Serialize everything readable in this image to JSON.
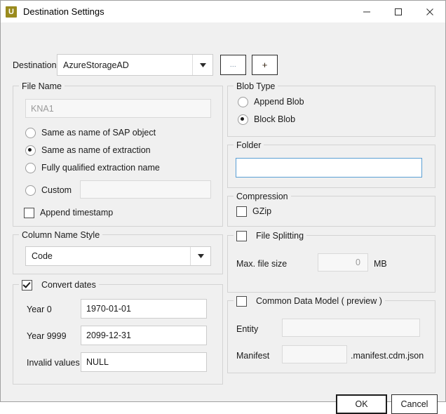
{
  "window": {
    "title": "Destination Settings",
    "app_icon": "u-app-icon",
    "icon_letter": "U",
    "controls": {
      "minimize": "minimize-icon",
      "maximize": "maximize-icon",
      "close": "close-icon"
    }
  },
  "destination": {
    "label": "Destination",
    "value": "AzureStorageAD",
    "dropdown_icon": "chevron-down-icon",
    "browse_button": "...",
    "add_button": "+"
  },
  "file_name": {
    "title": "File Name",
    "preview_value": "KNA1",
    "options": [
      {
        "label": "Same as name of SAP object",
        "checked": false
      },
      {
        "label": "Same as name of extraction",
        "checked": true
      },
      {
        "label": "Fully qualified extraction name",
        "checked": false
      },
      {
        "label": "Custom",
        "checked": false
      }
    ],
    "custom_value": "",
    "append_timestamp": {
      "label": "Append timestamp",
      "checked": false
    }
  },
  "column_name_style": {
    "title": "Column Name Style",
    "value": "Code",
    "dropdown_icon": "chevron-down-icon"
  },
  "convert_dates": {
    "title": "Convert dates",
    "checked": true,
    "fields": [
      {
        "label": "Year 0",
        "value": "1970-01-01"
      },
      {
        "label": "Year 9999",
        "value": "2099-12-31"
      },
      {
        "label": "Invalid values",
        "value": "NULL"
      }
    ]
  },
  "blob_type": {
    "title": "Blob Type",
    "options": [
      {
        "label": "Append Blob",
        "checked": false
      },
      {
        "label": "Block Blob",
        "checked": true
      }
    ]
  },
  "folder": {
    "title": "Folder",
    "value": "",
    "focused": true
  },
  "compression": {
    "title": "Compression",
    "gzip": {
      "label": "GZip",
      "checked": false
    }
  },
  "file_splitting": {
    "title": "File Splitting",
    "checked": false,
    "max_file_size_label": "Max. file size",
    "max_file_size_value": "0",
    "unit": "MB"
  },
  "common_data_model": {
    "title": "Common Data Model ( preview )",
    "checked": false,
    "entity_label": "Entity",
    "entity_value": "",
    "manifest_label": "Manifest",
    "manifest_value": "",
    "manifest_suffix": ".manifest.cdm.json"
  },
  "footer": {
    "ok": "OK",
    "cancel": "Cancel"
  },
  "colors": {
    "window_bg": "#f0f0f0",
    "titlebar_bg": "#ffffff",
    "accent_focus": "#5a9fd4",
    "app_icon": "#9a8b1e",
    "group_border": "#d3d3d3"
  }
}
